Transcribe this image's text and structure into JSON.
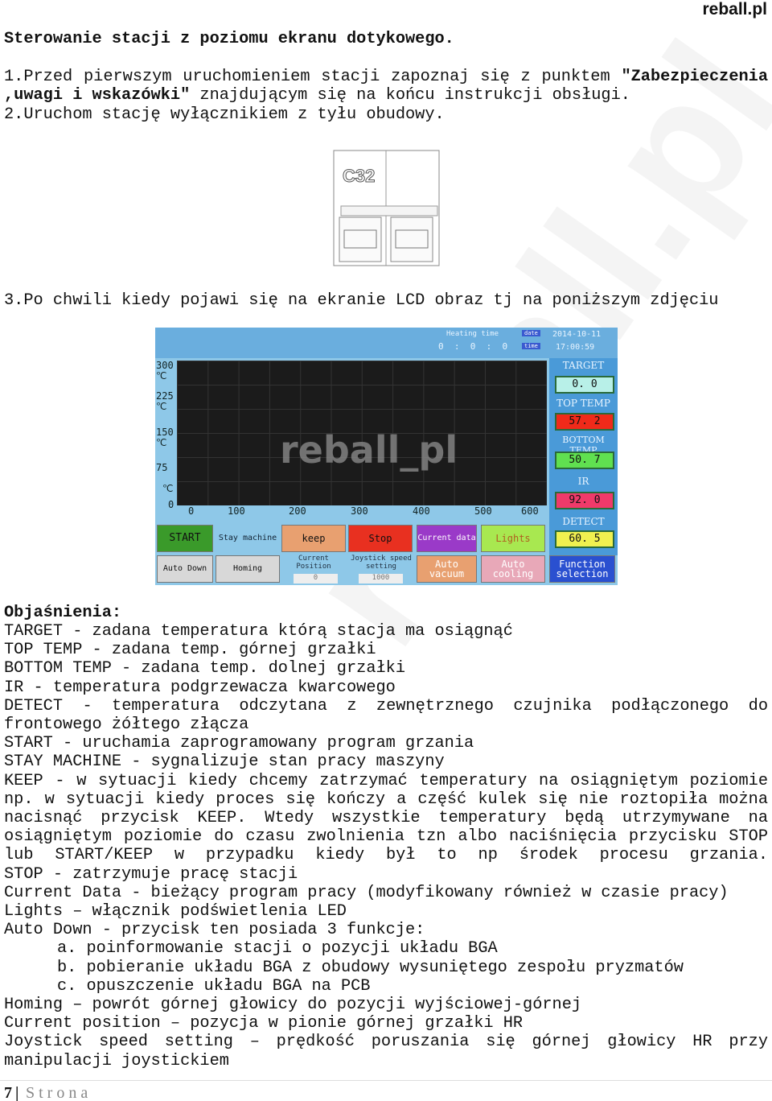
{
  "brand": "reball.pl",
  "watermark": "reball.pl",
  "title": "Sterowanie stacji z poziomu ekranu dotykowego.",
  "intro": {
    "l1": "1.Przed pierwszym uruchomieniem stacji zapoznaj się z punktem",
    "l1b": "\"Zabezpieczenia",
    "l2b": ",uwagi i wskazówki\"",
    "l2": " znajdującym się na końcu instrukcji obsługi.",
    "l3": "2.Uruchom stację wyłącznikiem z tyłu obudowy.",
    "l4": "3.Po chwili kiedy pojawi się na ekranie LCD obraz tj na poniższym zdjęciu"
  },
  "breaker_label": "C32",
  "lcd": {
    "heating_time_label": "Heating time",
    "heating_time": "0  :  0  :  0",
    "date_tag": "date",
    "date": "2014-10-11",
    "time_tag": "time",
    "time": "17:00:59",
    "y_ticks": [
      "300\n℃",
      "225\n℃",
      "150\n℃",
      "75",
      "℃",
      "0"
    ],
    "x_ticks": [
      "0",
      "100",
      "200",
      "300",
      "400",
      "500",
      "600"
    ],
    "chart_watermark": "reball_pl",
    "target_label": "TARGET",
    "target": "0. 0",
    "top_label": "TOP TEMP",
    "top": "57. 2",
    "bottom_label": "BOTTOM TEMP",
    "bottom": "50. 7",
    "ir_label": "IR",
    "ir": "92. 0",
    "detect_label": "DETECT",
    "detect": "60. 5",
    "buttons": {
      "start": "START",
      "stay": "Stay machine",
      "keep": "keep",
      "stop": "Stop",
      "current_data": "Current data",
      "lights": "Lights",
      "auto_down": "Auto Down",
      "homing": "Homing",
      "auto_vacuum": "Auto vacuum",
      "auto_cooling": "Auto cooling",
      "function": "Function selection"
    },
    "current_position_label": "Current Position",
    "current_position": "0",
    "joystick_label": "Joystick speed setting",
    "joystick": "1000"
  },
  "explanations_title": "Objaśnienia:",
  "lines": [
    "TARGET - zadana temperatura którą stacja ma osiągnąć",
    "TOP TEMP - zadana temp. górnej grzałki",
    "BOTTOM TEMP - zadana temp. dolnej grzałki",
    "IR - temperatura podgrzewacza kwarcowego",
    "DETECT - temperatura odczytana z zewnętrznego czujnika podłączonego do",
    "frontowego żółtego złącza",
    "START - uruchamia zaprogramowany program grzania",
    "STAY MACHINE - sygnalizuje stan pracy maszyny",
    "KEEP - w sytuacji kiedy chcemy zatrzymać temperatury na osiągniętym poziomie",
    "np. w sytuacji kiedy proces się kończy a część kulek się nie roztopiła można",
    "nacisnąć przycisk KEEP. Wtedy wszystkie temperatury będą utrzymywane na",
    "osiągniętym poziomie do czasu zwolnienia tzn albo naciśnięcia przycisku STOP",
    "lub START/KEEP w przypadku kiedy był to np środek procesu grzania.",
    "STOP - zatrzymuje pracę stacji",
    "Current Data - bieżący program pracy (modyfikowany również w czasie pracy)",
    "Lights – włącznik podświetlenia LED",
    "Auto Down - przycisk ten posiada 3 funkcje:",
    "a. poinformowanie stacji o pozycji układu BGA",
    "b. pobieranie układu BGA z obudowy wysuniętego zespołu pryzmatów",
    "c. opuszczenie układu BGA na PCB",
    "Homing – powrót górnej głowicy do pozycji wyjściowej-górnej",
    "Current position – pozycja w pionie górnej grzałki HR",
    "Joystick speed setting – prędkość poruszania się górnej głowicy HR przy",
    "manipulacji joystickiem"
  ],
  "footer": {
    "page": "7",
    "sep": "|",
    "label": "S t r o n a"
  }
}
